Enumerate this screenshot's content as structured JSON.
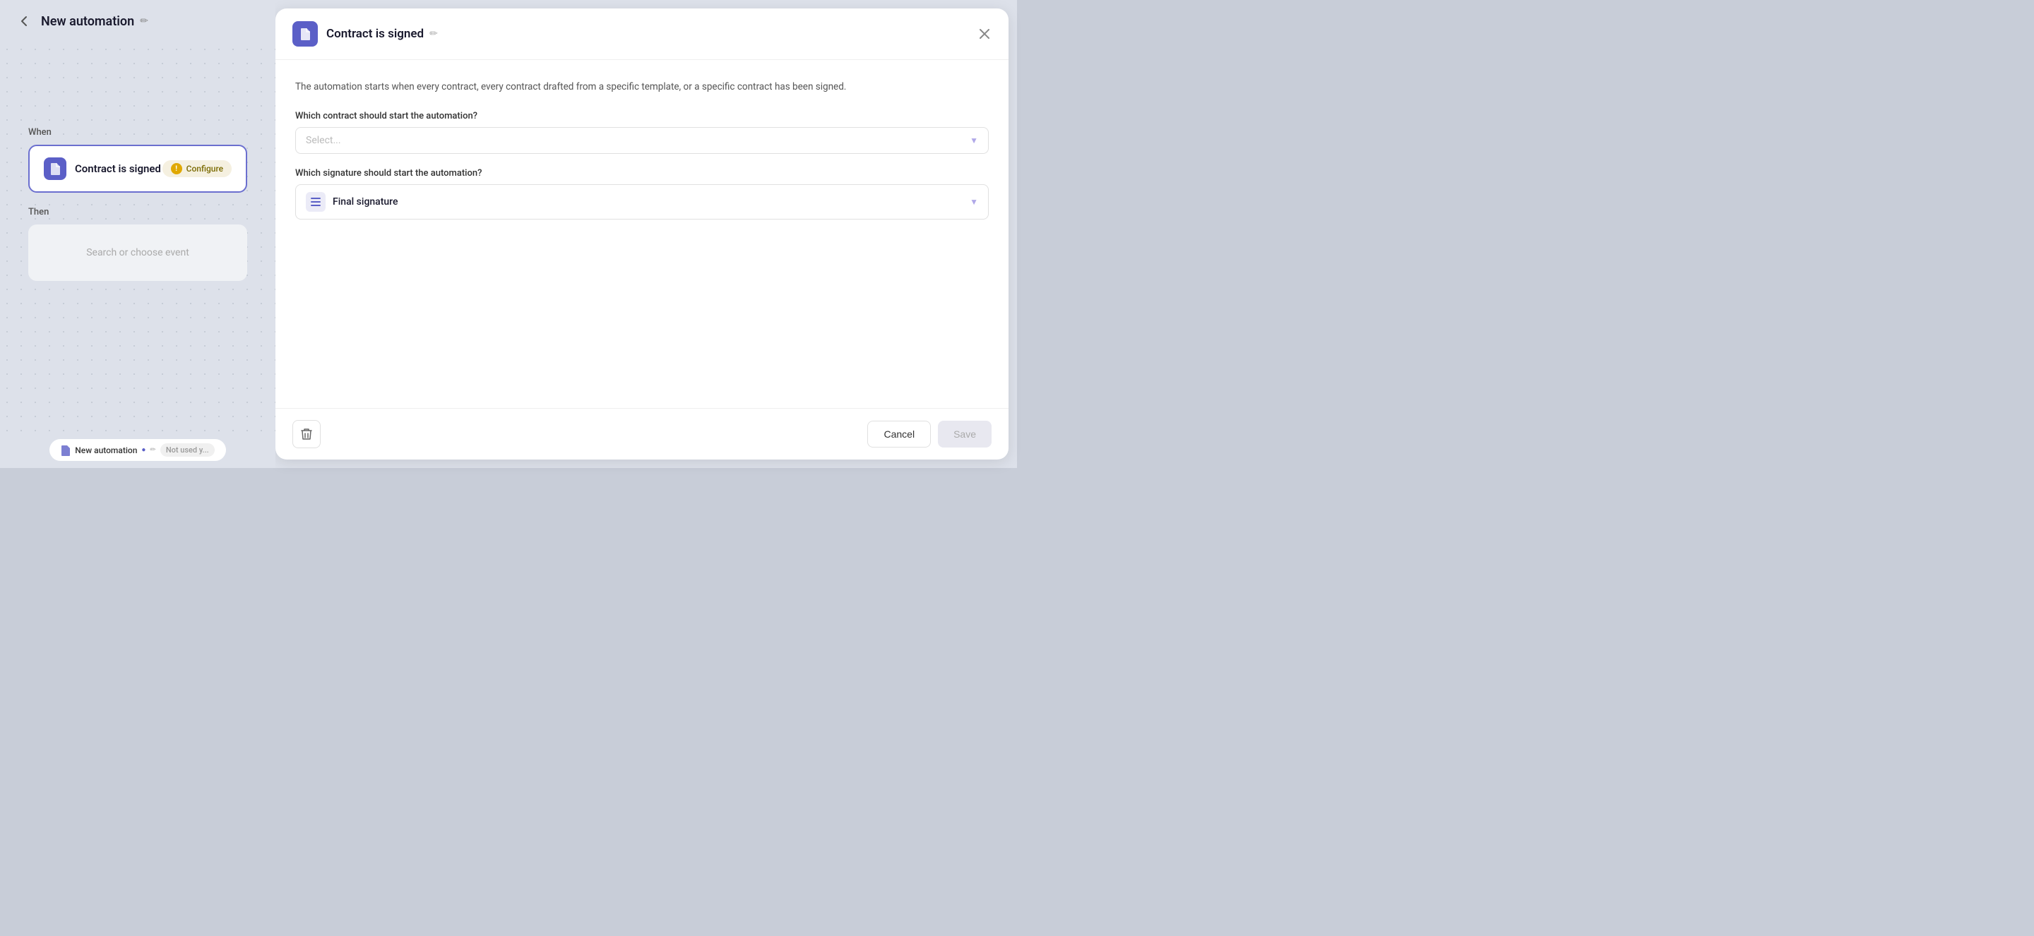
{
  "header": {
    "back_label": "←",
    "title": "New automation",
    "edit_icon": "✏"
  },
  "left_panel": {
    "when_label": "When",
    "trigger": {
      "icon": "📄",
      "title": "Contract is signed",
      "configure_label": "Configure",
      "warning": "!"
    },
    "then_label": "Then",
    "search_placeholder": "Search or choose event"
  },
  "bottom_bar": {
    "tab_icon": "📄",
    "tab_label": "New automation",
    "icon2": "🔵",
    "icon3": "✏",
    "not_used_label": "Not used y..."
  },
  "right_panel": {
    "header": {
      "icon": "📄",
      "title": "Contract is signed",
      "edit_icon": "✏",
      "close_icon": "✕"
    },
    "description": "The automation starts when every contract, every contract drafted from a specific template, or a specific contract has been signed.",
    "contract_question": "Which contract should start the automation?",
    "contract_placeholder": "Select...",
    "signature_question": "Which signature should start the automation?",
    "signature_value": "Final signature",
    "list_icon": "≡"
  },
  "footer": {
    "delete_icon": "🗑",
    "cancel_label": "Cancel",
    "save_label": "Save"
  }
}
